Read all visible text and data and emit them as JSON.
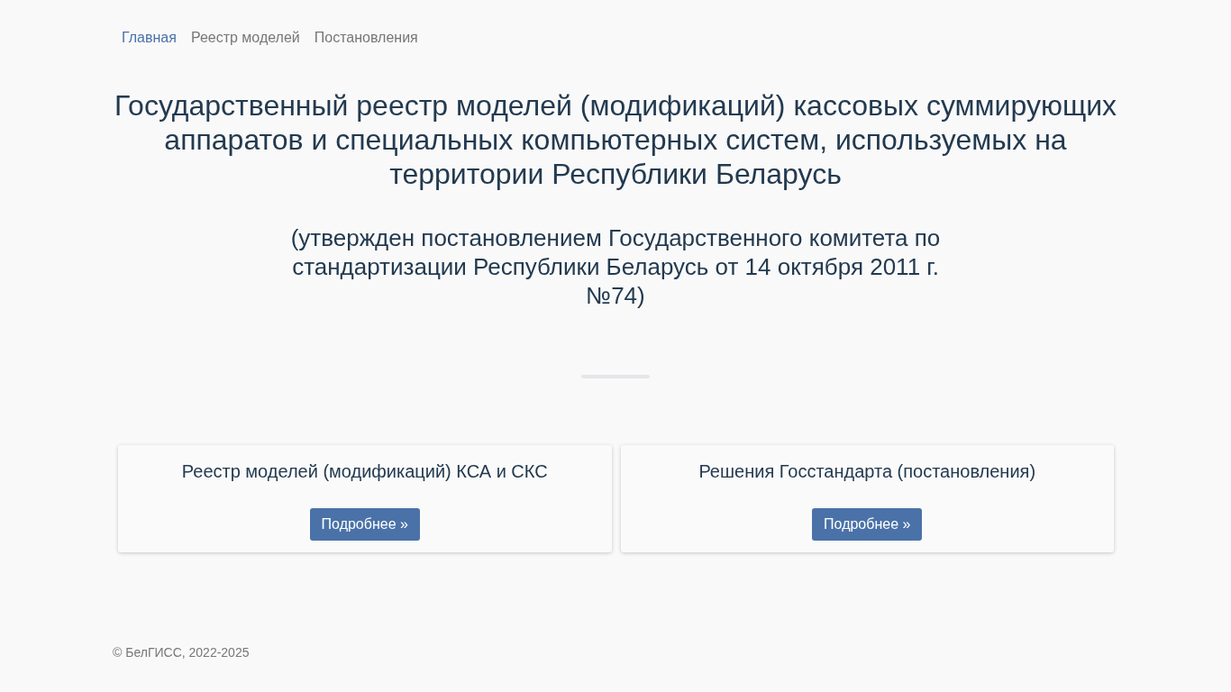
{
  "nav": [
    {
      "label": "Главная",
      "selected": true
    },
    {
      "label": "Реестр моделей",
      "selected": false
    },
    {
      "label": "Постановления",
      "selected": false
    }
  ],
  "title": "Государственный реестр моделей (модификаций) кассовых суммирующих аппаратов и специальных компьютерных систем, используемых на территории Республики Беларусь",
  "subtitle": "(утвержден постановлением Государственного комитета по стандартизации Республики Беларусь от 14 октября 2011 г. №74)",
  "cards": [
    {
      "title": "Реестр моделей (модификаций) КСА и СКС",
      "button": "Подробнее »"
    },
    {
      "title": "Решения Госстандарта (постановления)",
      "button": "Подробнее »"
    }
  ],
  "footer": "© БелГИСС, 2022-2025"
}
